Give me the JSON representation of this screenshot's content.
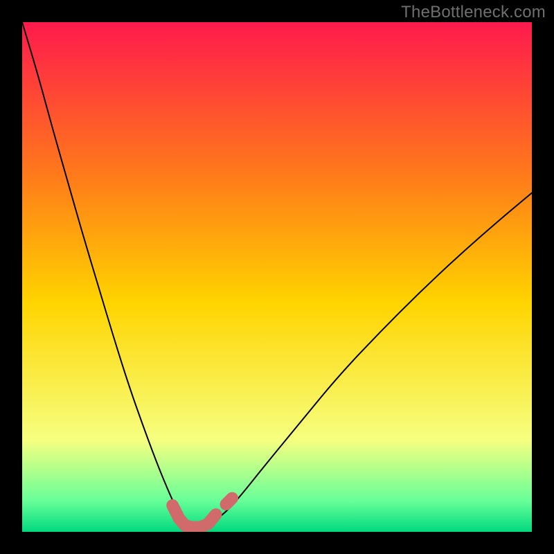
{
  "watermark": "TheBottleneck.com",
  "chart_data": {
    "type": "line",
    "title": "",
    "xlabel": "",
    "ylabel": "",
    "xlim": [
      0,
      100
    ],
    "ylim": [
      0,
      100
    ],
    "grid": false,
    "legend": false,
    "background_gradient": {
      "top": "#ff1a4d",
      "upper_mid": "#ff7a1a",
      "mid": "#ffd400",
      "lower_mid": "#f6ff80",
      "lower": "#66ff99",
      "bottom": "#00d97e"
    },
    "series": [
      {
        "name": "bottleneck-curve",
        "color": "#000000",
        "x": [
          0,
          3,
          6,
          9,
          12,
          15,
          18,
          21,
          24,
          27,
          30,
          31.5,
          33,
          34.5,
          36,
          39,
          42,
          48,
          55,
          62,
          70,
          78,
          86,
          94,
          100
        ],
        "y": [
          100,
          90,
          79,
          68.5,
          58,
          48,
          38,
          28.5,
          20,
          12,
          5,
          2.5,
          1,
          1,
          1.2,
          3,
          6,
          13.5,
          22,
          30.5,
          39,
          47,
          54.5,
          61.5,
          66.5
        ]
      }
    ],
    "marker_runs": [
      {
        "name": "optimal-band",
        "color": "#d16a6a",
        "stroke_width_pct": 2.4,
        "x": [
          29.5,
          30.8,
          32,
          33.5,
          35,
          36.5,
          38
        ],
        "y": [
          5.2,
          2.6,
          1.2,
          0.9,
          0.9,
          1.6,
          3.4
        ]
      },
      {
        "name": "optimal-outlier",
        "color": "#d16a6a",
        "stroke_width_pct": 2.4,
        "x": [
          40,
          41.2
        ],
        "y": [
          5.4,
          6.6
        ]
      }
    ]
  }
}
